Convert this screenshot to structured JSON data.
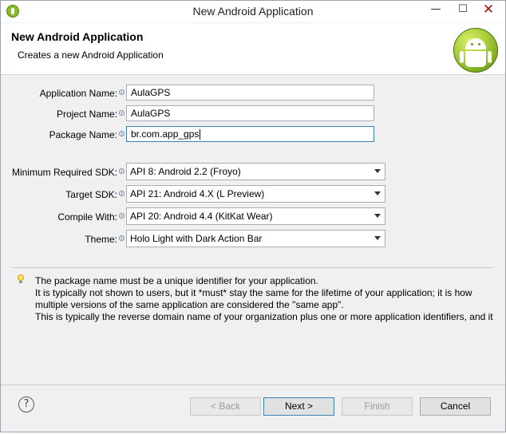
{
  "window": {
    "title": "New Android Application",
    "minimize": "—",
    "maximize": "☐",
    "close": "✕"
  },
  "header": {
    "title": "New Android Application",
    "subtitle": "Creates a new Android Application"
  },
  "form": {
    "app_name_label": "Application Name:",
    "app_name_value": "AulaGPS",
    "project_name_label": "Project Name:",
    "project_name_value": "AulaGPS",
    "package_name_label": "Package Name:",
    "package_name_value": "br.com.app_gps",
    "min_sdk_label": "Minimum Required SDK:",
    "min_sdk_value": "API 8: Android 2.2 (Froyo)",
    "target_sdk_label": "Target SDK:",
    "target_sdk_value": "API 21: Android 4.X (L Preview)",
    "compile_with_label": "Compile With:",
    "compile_with_value": "API 20: Android 4.4 (KitKat Wear)",
    "theme_label": "Theme:",
    "theme_value": "Holo Light with Dark Action Bar"
  },
  "hint": {
    "line1": "The package name must be a unique identifier for your application.",
    "line2": "It is typically not shown to users, but it *must* stay the same for the lifetime of your application; it is how",
    "line3": "multiple versions of the same application are considered the \"same app\".",
    "line4": "This is typically the reverse domain name of your organization plus one or more application identifiers, and it"
  },
  "buttons": {
    "help": "?",
    "back": "< Back",
    "next": "Next >",
    "finish": "Finish",
    "cancel": "Cancel"
  },
  "colors": {
    "accent": "#3c7fb1",
    "android_green": "#a5cc36"
  }
}
